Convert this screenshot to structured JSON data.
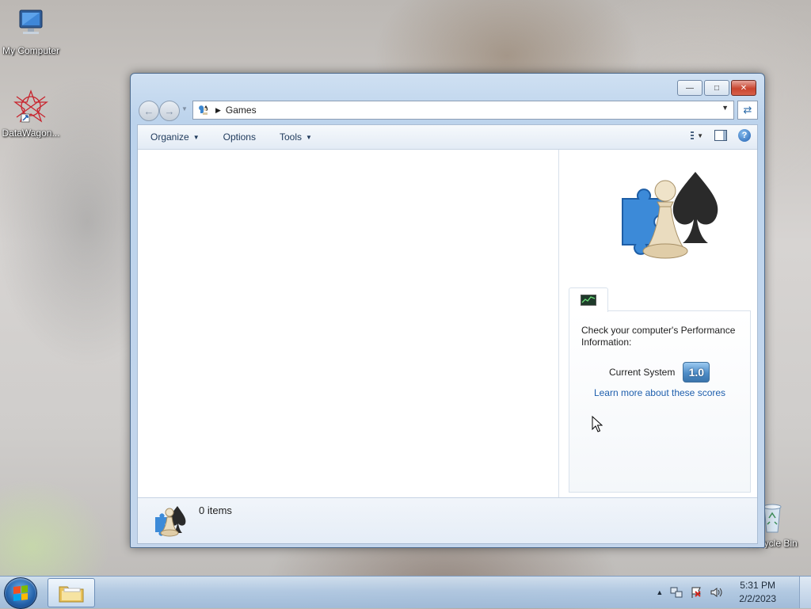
{
  "desktop": {
    "icons": [
      {
        "label": "My Computer"
      },
      {
        "label": "DataWagon..."
      },
      {
        "label": "Recycle Bin"
      }
    ]
  },
  "window": {
    "address": {
      "current_location": "Games"
    },
    "toolbar": {
      "organize_label": "Organize",
      "options_label": "Options",
      "tools_label": "Tools",
      "help_label": "?"
    },
    "performance": {
      "title": "Check your computer's Performance Information:",
      "current_system_label": "Current System",
      "score": "1.0",
      "learn_more_link": "Learn more about these scores"
    },
    "details": {
      "item_count": "0 items"
    }
  },
  "taskbar": {
    "clock_time": "5:31 PM",
    "clock_date": "2/2/2023"
  },
  "colors": {
    "window_frame": "#bcd3ec",
    "link": "#1f5fad",
    "score_badge": "#4e8dc8",
    "close_button": "#c9452f"
  }
}
